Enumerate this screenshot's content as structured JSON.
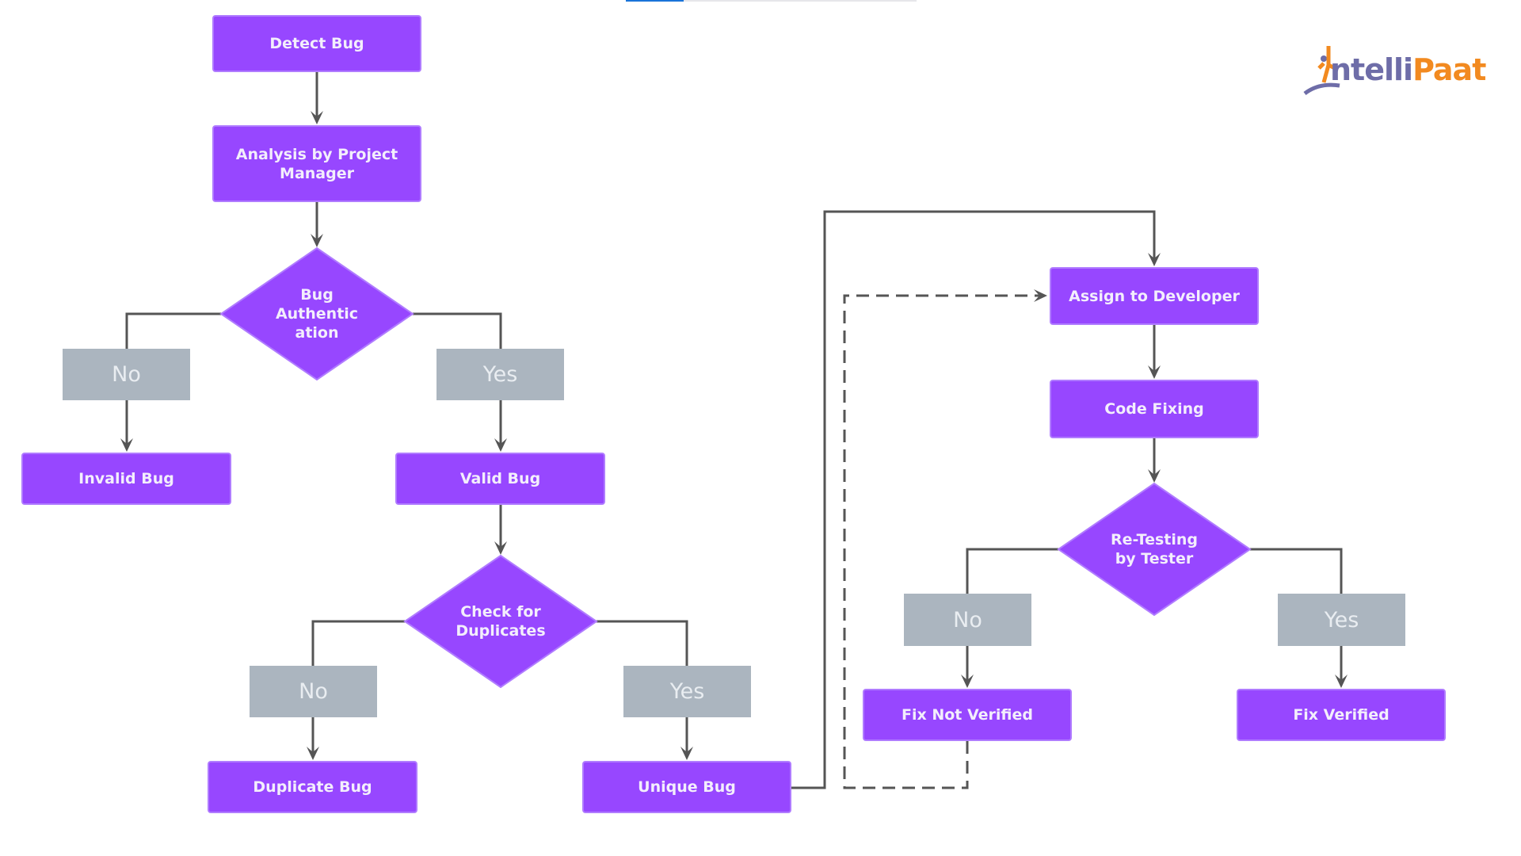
{
  "progress": {
    "value_percent": 20,
    "fill_color": "#1a73d9"
  },
  "logo": {
    "part1": "ntelli",
    "part2": "Paat",
    "brand_colors": {
      "primary": "#6e6da8",
      "accent": "#f28a20"
    }
  },
  "colors": {
    "process": "#9747ff",
    "label": "#abb5bf",
    "connector": "#555555"
  },
  "nodes": {
    "detect_bug": "Detect Bug",
    "analysis": "Analysis by Project Manager",
    "bug_authentication": "Bug Authentic ation",
    "auth_no": "No",
    "auth_yes": "Yes",
    "invalid_bug": "Invalid Bug",
    "valid_bug": "Valid Bug",
    "check_duplicates": "Check for Duplicates",
    "dup_no": "No",
    "dup_yes": "Yes",
    "duplicate_bug": "Duplicate Bug",
    "unique_bug": "Unique Bug",
    "assign_developer": "Assign to Developer",
    "code_fixing": "Code Fixing",
    "retesting": "Re-Testing by Tester",
    "retest_no": "No",
    "retest_yes": "Yes",
    "fix_not_verified": "Fix Not Verified",
    "fix_verified": "Fix Verified"
  }
}
